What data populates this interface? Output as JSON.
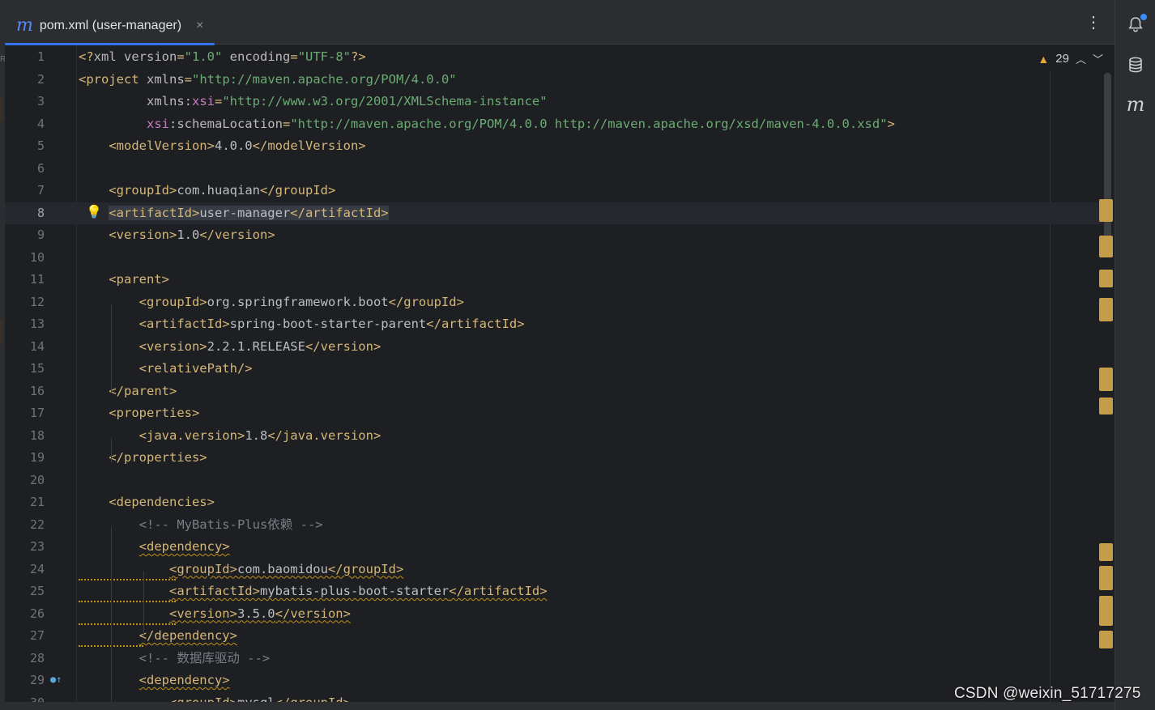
{
  "tab": {
    "icon_letter": "m",
    "title": "pom.xml (user-manager)",
    "close": "×"
  },
  "toolbar": {
    "more": "⋮"
  },
  "inspection": {
    "count": "29"
  },
  "right_tools": {
    "maven_letter": "m"
  },
  "left_strip": {
    "glyph": "R"
  },
  "watermark": "CSDN @weixin_51717275",
  "colors": {
    "accent": "#3574f0",
    "tag": "#d5b778",
    "string": "#6aab73",
    "namespace": "#c77dbb",
    "comment": "#7a7e85",
    "warning": "#c39d48"
  },
  "lines": [
    {
      "n": "1",
      "segs": [
        [
          "t",
          "<?"
        ],
        [
          "a",
          "xml version"
        ],
        [
          "t",
          "="
        ],
        [
          "v",
          "\"1.0\""
        ],
        [
          "a",
          " encoding"
        ],
        [
          "t",
          "="
        ],
        [
          "v",
          "\"UTF-8\""
        ],
        [
          "t",
          "?>"
        ]
      ]
    },
    {
      "n": "2",
      "segs": [
        [
          "t",
          "<project "
        ],
        [
          "a",
          "xmlns"
        ],
        [
          "t",
          "="
        ],
        [
          "v",
          "\"http://maven.apache.org/POM/4.0.0\""
        ]
      ]
    },
    {
      "n": "3",
      "segs": [
        [
          "a",
          "         xmlns:"
        ],
        [
          "ns",
          "xsi"
        ],
        [
          "t",
          "="
        ],
        [
          "v",
          "\"http://www.w3.org/2001/XMLSchema-instance\""
        ]
      ]
    },
    {
      "n": "4",
      "segs": [
        [
          "ns",
          "         xsi"
        ],
        [
          "a",
          ":schemaLocation"
        ],
        [
          "t",
          "="
        ],
        [
          "v",
          "\"http://maven.apache.org/POM/4.0.0 http://maven.apache.org/xsd/maven-4.0.0.xsd\""
        ],
        [
          "t",
          ">"
        ]
      ]
    },
    {
      "n": "5",
      "segs": [
        [
          "t",
          "    <modelVersion>"
        ],
        [
          "txt",
          "4.0.0"
        ],
        [
          "t",
          "</modelVersion>"
        ]
      ]
    },
    {
      "n": "6",
      "segs": []
    },
    {
      "n": "7",
      "segs": [
        [
          "t",
          "    <groupId>"
        ],
        [
          "txt",
          "com.huaqian"
        ],
        [
          "t",
          "</groupId>"
        ]
      ]
    },
    {
      "n": "8",
      "segs": [
        [
          "txt",
          "    "
        ],
        [
          "t sel",
          "<artifactId>"
        ],
        [
          "txt sel",
          "user-manager"
        ],
        [
          "t sel",
          "</artifactId>"
        ]
      ]
    },
    {
      "n": "9",
      "segs": [
        [
          "t",
          "    <version>"
        ],
        [
          "txt",
          "1.0"
        ],
        [
          "t",
          "</version>"
        ]
      ]
    },
    {
      "n": "10",
      "segs": []
    },
    {
      "n": "11",
      "segs": [
        [
          "t",
          "    <parent>"
        ]
      ]
    },
    {
      "n": "12",
      "segs": [
        [
          "t",
          "        <groupId>"
        ],
        [
          "txt",
          "org.springframework.boot"
        ],
        [
          "t",
          "</groupId>"
        ]
      ]
    },
    {
      "n": "13",
      "segs": [
        [
          "t",
          "        <artifactId>"
        ],
        [
          "txt",
          "spring-boot-starter-parent"
        ],
        [
          "t",
          "</artifactId>"
        ]
      ]
    },
    {
      "n": "14",
      "segs": [
        [
          "t",
          "        <version>"
        ],
        [
          "txt",
          "2.2.1.RELEASE"
        ],
        [
          "t",
          "</version>"
        ]
      ]
    },
    {
      "n": "15",
      "segs": [
        [
          "t",
          "        <relativePath/>"
        ]
      ]
    },
    {
      "n": "16",
      "segs": [
        [
          "t",
          "    </parent>"
        ]
      ]
    },
    {
      "n": "17",
      "segs": [
        [
          "t",
          "    <properties>"
        ]
      ]
    },
    {
      "n": "18",
      "segs": [
        [
          "t",
          "        <java.version>"
        ],
        [
          "txt",
          "1.8"
        ],
        [
          "t",
          "</java.version>"
        ]
      ]
    },
    {
      "n": "19",
      "segs": [
        [
          "t",
          "    </properties>"
        ]
      ]
    },
    {
      "n": "20",
      "segs": []
    },
    {
      "n": "21",
      "segs": [
        [
          "t",
          "    <dependencies>"
        ]
      ]
    },
    {
      "n": "22",
      "segs": [
        [
          "c",
          "        <!-- MyBatis-Plus依赖 -->"
        ]
      ]
    },
    {
      "n": "23",
      "segs": [
        [
          "txt",
          "        "
        ],
        [
          "t warn",
          "<dependency>"
        ]
      ]
    },
    {
      "n": "24",
      "segs": [
        [
          "txt",
          "            "
        ],
        [
          "t warn",
          "<groupId>"
        ],
        [
          "txt warn",
          "com.baomidou"
        ],
        [
          "t warn",
          "</groupId>"
        ]
      ]
    },
    {
      "n": "25",
      "segs": [
        [
          "txt",
          "            "
        ],
        [
          "t warn",
          "<artifactId>"
        ],
        [
          "txt warn",
          "mybatis-plus-boot-starter"
        ],
        [
          "t warn",
          "</artifactId>"
        ]
      ]
    },
    {
      "n": "26",
      "segs": [
        [
          "txt",
          "            "
        ],
        [
          "t warn",
          "<version>"
        ],
        [
          "txt warn",
          "3.5.0"
        ],
        [
          "t warn",
          "</version>"
        ]
      ]
    },
    {
      "n": "27",
      "segs": [
        [
          "txt",
          "        "
        ],
        [
          "t warn",
          "</dependency>"
        ]
      ]
    },
    {
      "n": "28",
      "segs": [
        [
          "c",
          "        <!-- 数据库驱动 -->"
        ]
      ]
    },
    {
      "n": "29",
      "segs": [
        [
          "txt",
          "        "
        ],
        [
          "t warn",
          "<dependency>"
        ]
      ]
    },
    {
      "n": "30",
      "segs": [
        [
          "txt",
          "            "
        ],
        [
          "t",
          "<groupId>"
        ],
        [
          "txt",
          "mysql"
        ],
        [
          "t",
          "</groupId>"
        ]
      ]
    }
  ]
}
